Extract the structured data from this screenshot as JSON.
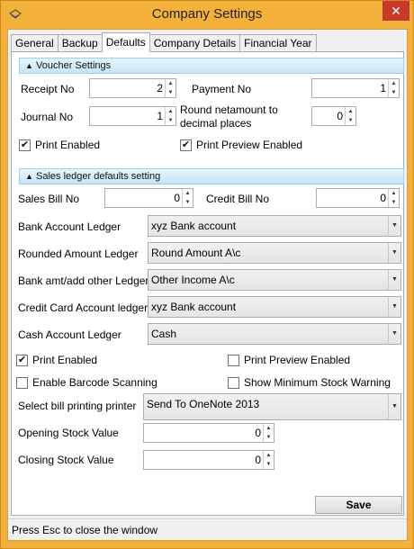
{
  "window": {
    "title": "Company Settings",
    "close_glyph": "✕"
  },
  "tabs": [
    {
      "label": "General",
      "active": false
    },
    {
      "label": "Backup",
      "active": false
    },
    {
      "label": "Defaults",
      "active": true
    },
    {
      "label": "Company Details",
      "active": false
    },
    {
      "label": "Financial Year",
      "active": false
    }
  ],
  "voucher": {
    "header": "Voucher Settings",
    "receipt_no_label": "Receipt No",
    "receipt_no": "2",
    "payment_no_label": "Payment No",
    "payment_no": "1",
    "journal_no_label": "Journal No",
    "journal_no": "1",
    "round_label_line1": "Round netamount to",
    "round_label_line2": "decimal places",
    "round_value": "0",
    "print_enabled_label": "Print Enabled",
    "print_enabled": true,
    "print_preview_label": "Print Preview Enabled",
    "print_preview": true
  },
  "sales": {
    "header": "Sales ledger defaults setting",
    "sales_bill_label": "Sales Bill No",
    "sales_bill": "0",
    "credit_bill_label": "Credit Bill No",
    "credit_bill": "0",
    "bank_account_label": "Bank Account Ledger",
    "bank_account": "xyz Bank account",
    "rounded_amount_label": "Rounded Amount Ledger",
    "rounded_amount": "Round Amount A\\c",
    "bank_amt_label": "Bank amt/add other Ledger",
    "bank_amt": "Other Income A\\c",
    "credit_card_label": "Credit Card Account ledger",
    "credit_card": "xyz Bank account",
    "cash_account_label": "Cash Account Ledger",
    "cash_account": "Cash",
    "print_enabled_label": "Print Enabled",
    "print_enabled": true,
    "print_preview_label": "Print Preview Enabled",
    "print_preview": false,
    "barcode_label": "Enable Barcode Scanning",
    "barcode": false,
    "min_stock_label": "Show Minimum Stock Warning",
    "min_stock": false,
    "printer_label": "Select bill printing printer",
    "printer": "Send To OneNote 2013",
    "opening_stock_label": "Opening Stock Value",
    "opening_stock": "0",
    "closing_stock_label": "Closing Stock Value",
    "closing_stock": "0"
  },
  "save_label": "Save",
  "status_text": "Press Esc to close the window",
  "icons": {
    "check": "✔",
    "up": "▲",
    "down": "▼",
    "collapse": "⮝"
  },
  "colors": {
    "title_bar": "#f3b13b",
    "close": "#c7392a",
    "section_header": "#c5e5f7"
  }
}
